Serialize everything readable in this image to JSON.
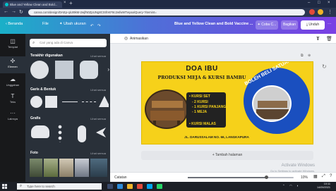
{
  "browser": {
    "tab_title": "Blue and Yellow Clean and Bold...",
    "tab_close": "×",
    "new_tab": "+",
    "url": "canva.com/design/DAEp-qiUI9kM-2wjfN0ZpUNg8CtSfnKF8c2wfwWTwyaa/Query-?itemint=",
    "nav_back": "←",
    "nav_forward": "→",
    "nav_reload": "↻",
    "window_min": "–",
    "window_max": "□",
    "window_close": "×"
  },
  "topbar": {
    "beranda": "‹  Beranda",
    "file": "File",
    "ubah_ukuran": "✦ Ubah ukuran",
    "doc_title": "Blue and Yellow Clean and Bold Vaccine ...",
    "coba_label": "✦ Coba C...",
    "bagikan": "Bagikan",
    "unduh": "⤓  Unduh",
    "more": "···"
  },
  "rail": {
    "items": [
      {
        "label": "Templat"
      },
      {
        "label": "Elemen"
      },
      {
        "label": "Unggahan"
      },
      {
        "label": "Teks"
      },
      {
        "label": "Lainnya"
      }
    ]
  },
  "panel": {
    "search_placeholder": "Cari yang ada di Canva",
    "sections": [
      {
        "title": "Terakhir digunakan",
        "more": "Lihat semua"
      },
      {
        "title": "Garis & Bentuk",
        "more": "Lihat semua"
      },
      {
        "title": "Grafis",
        "more": "Lihat semua"
      },
      {
        "title": "Foto",
        "more": "Lihat semua"
      }
    ]
  },
  "editor": {
    "animasikan": "Animasikan",
    "add_page": "+ Tambah halaman",
    "catatan": "Catatan",
    "zoom": "10%",
    "zoom_level": 0.74,
    "activation_title": "Activate Windows",
    "activation_sub": "Go to Settings to activate Windows."
  },
  "design": {
    "title": "DOA IBU",
    "subtitle": "PRODUKSI MEJA & KURSI BAMBU",
    "list": [
      "• KURSI SET",
      "- 2 KURSI",
      "- 1 KURSI PANJANG",
      "- 1 MEJA"
    ],
    "malas": "• KURSI MALAS",
    "address": "JL. DARUSSALAM NO. 66, LANGKAPURA",
    "badge_text": "BOLEH BELI SATUAN"
  },
  "taskbar": {
    "search_placeholder": "Type here to search",
    "time": "10:11",
    "date": "14/09/2021"
  },
  "colors": {
    "canva_start": "#1ab0c8",
    "canva_end": "#7b3fe4",
    "design_bg": "#f6d11a",
    "badge_blue": "#1a4fbf"
  }
}
